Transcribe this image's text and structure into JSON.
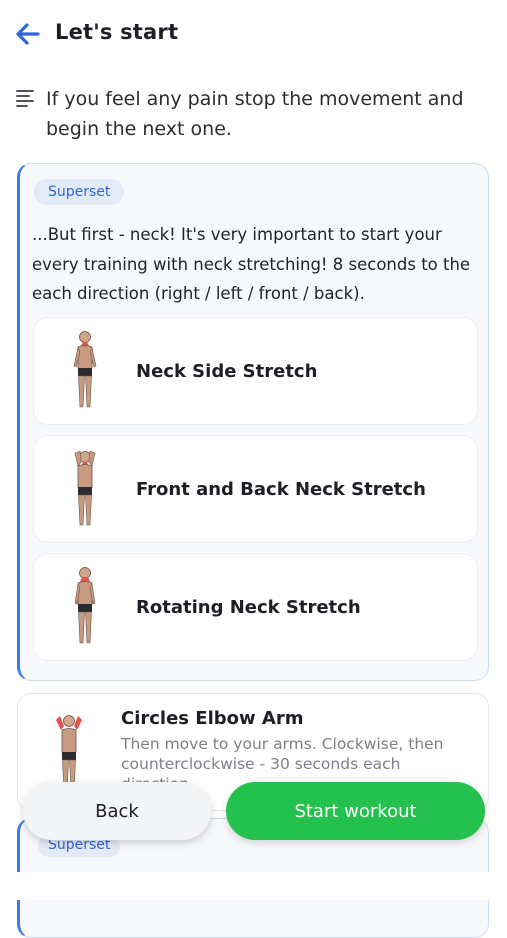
{
  "header": {
    "title": "Let's start",
    "back_icon": "arrow-left-icon"
  },
  "note": {
    "icon": "text-lines-icon",
    "text": "If you feel any pain stop the movement and begin the next one."
  },
  "superset": {
    "badge": "Superset",
    "description": "...But first - neck! It's very important to start your every training with neck stretching! 8 seconds to the each direction (right / left / front / back).",
    "exercises": [
      {
        "name": "Neck Side Stretch"
      },
      {
        "name": "Front and Back Neck Stretch"
      },
      {
        "name": "Rotating Neck Stretch"
      }
    ]
  },
  "single_exercise": {
    "name": "Circles Elbow Arm",
    "description": "Then move to your arms. Clockwise, then counterclockwise - 30 seconds each direction"
  },
  "superset2": {
    "badge": "Superset"
  },
  "buttons": {
    "back": "Back",
    "start": "Start workout"
  },
  "colors": {
    "accent_blue": "#3f7de6",
    "start_green": "#25c14f",
    "highlight_red": "#e0534a"
  }
}
